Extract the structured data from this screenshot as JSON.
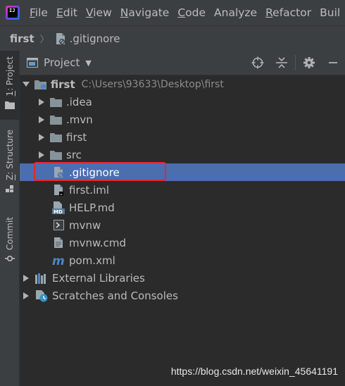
{
  "menubar": {
    "items": [
      {
        "mnemonic": "F",
        "rest": "ile"
      },
      {
        "mnemonic": "E",
        "rest": "dit"
      },
      {
        "mnemonic": "V",
        "rest": "iew"
      },
      {
        "mnemonic": "N",
        "rest": "avigate"
      },
      {
        "mnemonic": "C",
        "rest": "ode"
      },
      {
        "mnemonic": "",
        "rest": "Analyze"
      },
      {
        "mnemonic": "R",
        "rest": "efactor"
      },
      {
        "mnemonic": "",
        "rest": "Buil"
      }
    ]
  },
  "breadcrumb": {
    "root": "first",
    "separator": "〉",
    "file": ".gitignore"
  },
  "tool_windows": {
    "project": {
      "mnemonic": "1",
      "rest": ": Project"
    },
    "structure": {
      "mnemonic": "Z",
      "rest": ": Structure"
    },
    "commit": {
      "mnemonic": "",
      "rest": "Commit"
    }
  },
  "panel": {
    "title": "Project"
  },
  "tree": {
    "root_name": "first",
    "root_path": "C:\\Users\\93633\\Desktop\\first",
    "items": [
      {
        "label": ".idea",
        "icon": "folder-icon"
      },
      {
        "label": ".mvn",
        "icon": "folder-icon"
      },
      {
        "label": "first",
        "icon": "folder-icon"
      },
      {
        "label": "src",
        "icon": "folder-icon"
      },
      {
        "label": ".gitignore",
        "icon": "ignore-file-icon",
        "selected": true
      },
      {
        "label": "first.iml",
        "icon": "iml-file-icon"
      },
      {
        "label": "HELP.md",
        "icon": "markdown-file-icon"
      },
      {
        "label": "mvnw",
        "icon": "shell-file-icon"
      },
      {
        "label": "mvnw.cmd",
        "icon": "text-file-icon"
      },
      {
        "label": "pom.xml",
        "icon": "maven-icon"
      }
    ],
    "external_libraries": "External Libraries",
    "scratches": "Scratches and Consoles"
  },
  "colors": {
    "selection": "#4b6eaf",
    "highlight_box": "#e4262f",
    "background": "#2b2b2b",
    "chrome": "#3c3f41"
  },
  "watermark": "https://blog.csdn.net/weixin_45641191"
}
